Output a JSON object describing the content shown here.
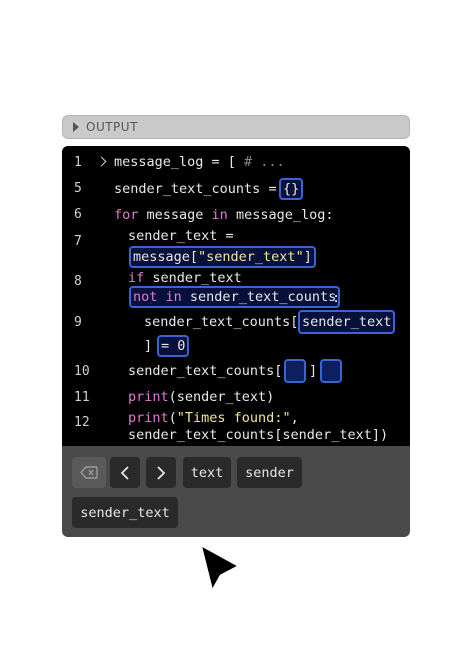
{
  "panel": {
    "title": "OUTPUT"
  },
  "code": {
    "line_numbers": [
      "1",
      "5",
      "6",
      "7",
      "8",
      "9",
      "10",
      "11",
      "12"
    ],
    "l1": {
      "name": "message_log",
      "op": " = [",
      "comment": " # ..."
    },
    "l5": {
      "name": "sender_text_counts",
      "op": " =",
      "slot": "{}"
    },
    "l6": {
      "kw_for": "for",
      "var": " message ",
      "kw_in": "in",
      "rest": " message_log:"
    },
    "l7": {
      "name": "sender_text =",
      "slot_pre": "message[",
      "slot_str": "\"sender_text\"",
      "slot_post": "]"
    },
    "l8": {
      "kw_if": "if",
      "rest": " sender_text",
      "slot_kw1": "not",
      "slot_kw2": "in",
      "slot_rest": " sender_text_counts",
      "colon": ":"
    },
    "l9": {
      "name": "sender_text_counts[",
      "slot": "sender_text",
      "close": "]",
      "slot2": "= 0"
    },
    "l10": {
      "name": "sender_text_counts[",
      "mid": "]"
    },
    "l11": {
      "fn": "print",
      "rest": "(sender_text)"
    },
    "l12": {
      "fn": "print",
      "open": "(",
      "str": "\"Times found:\"",
      "comma": ",",
      "cont": "sender_text_counts[sender_text])"
    }
  },
  "keyboard": {
    "backspace_icon": "backspace-icon",
    "left_label": "<",
    "right_label": ">",
    "key_text": "text",
    "key_sender": "sender",
    "key_sender_text": "sender_text"
  },
  "colors": {
    "slot_border": "#3a63d6",
    "keyword": "#e07bd2",
    "string": "#f2e6a0"
  }
}
